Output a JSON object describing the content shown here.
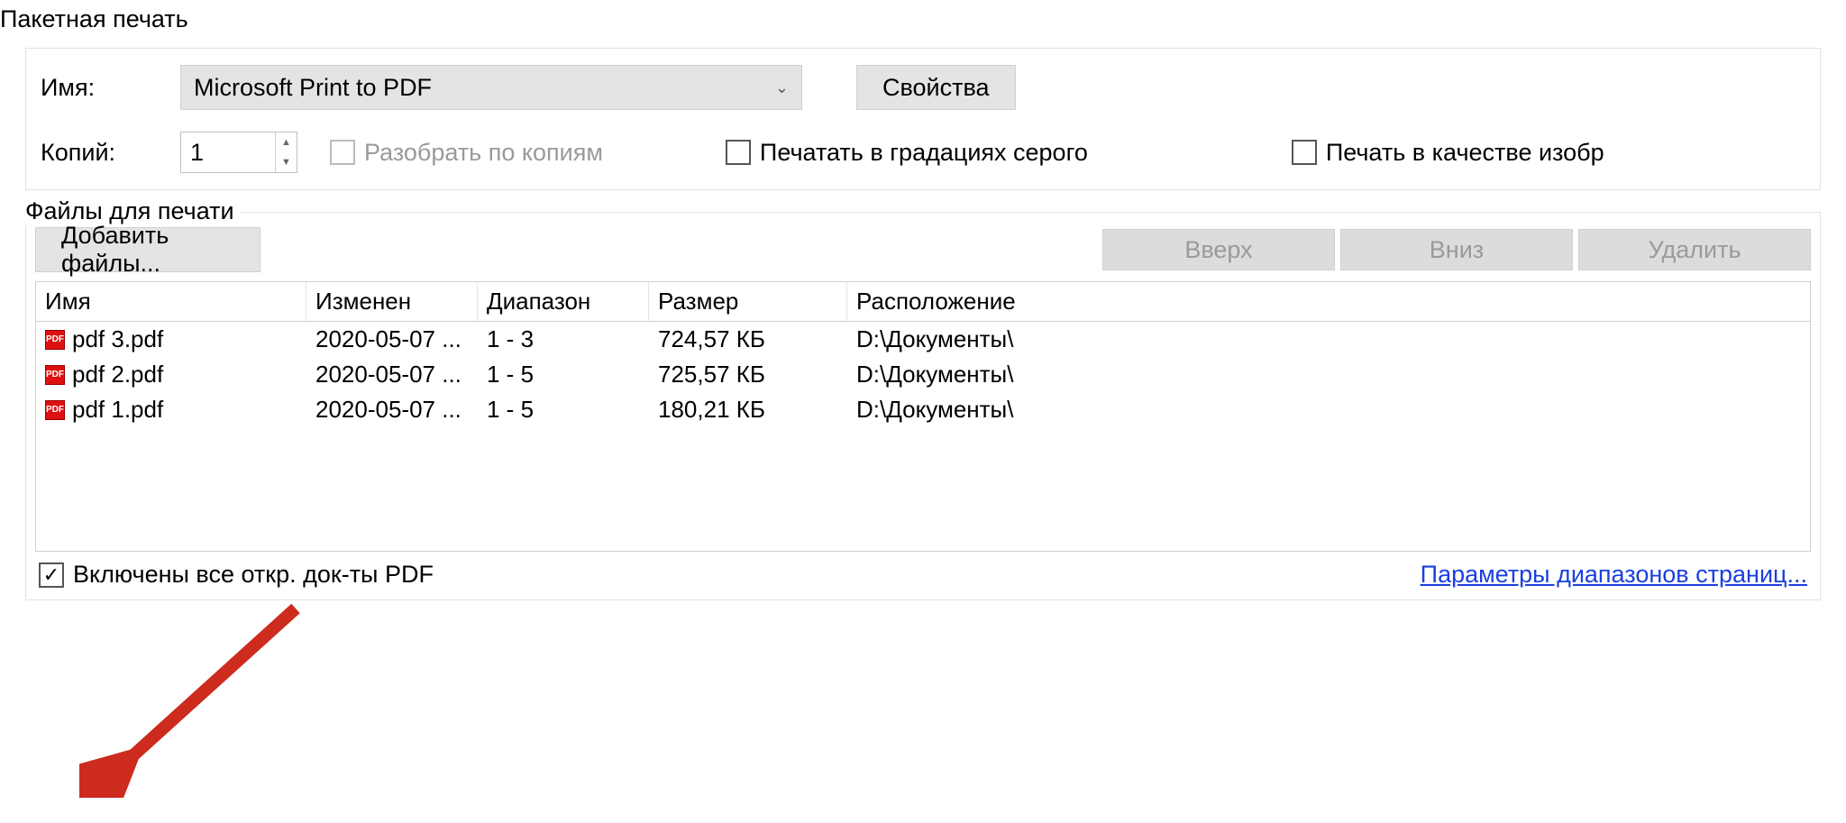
{
  "window_title": "Пакетная печать",
  "printer": {
    "name_label": "Имя:",
    "selected_printer": "Microsoft Print to PDF",
    "properties_btn": "Свойства",
    "copies_label": "Копий:",
    "copies_value": "1",
    "collate_label": "Разобрать по копиям",
    "grayscale_label": "Печатать в градациях серого",
    "image_quality_label": "Печать в качестве изобр"
  },
  "files": {
    "legend": "Файлы для печати",
    "add_btn": "Добавить файлы...",
    "up_btn": "Вверх",
    "down_btn": "Вниз",
    "delete_btn": "Удалить",
    "columns": {
      "name": "Имя",
      "modified": "Изменен",
      "range": "Диапазон",
      "size": "Размер",
      "location": "Расположение"
    },
    "rows": [
      {
        "name": "pdf 3.pdf",
        "modified": "2020-05-07 ...",
        "range": "1 - 3",
        "size": "724,57 КБ",
        "location": "D:\\Документы\\"
      },
      {
        "name": "pdf 2.pdf",
        "modified": "2020-05-07 ...",
        "range": "1 - 5",
        "size": "725,57 КБ",
        "location": "D:\\Документы\\"
      },
      {
        "name": "pdf 1.pdf",
        "modified": "2020-05-07 ...",
        "range": "1 - 5",
        "size": "180,21 КБ",
        "location": "D:\\Документы\\"
      }
    ],
    "include_open_label": "Включены все откр. док-ты PDF",
    "page_range_link": "Параметры диапазонов страниц...",
    "pdf_badge": "PDF"
  }
}
